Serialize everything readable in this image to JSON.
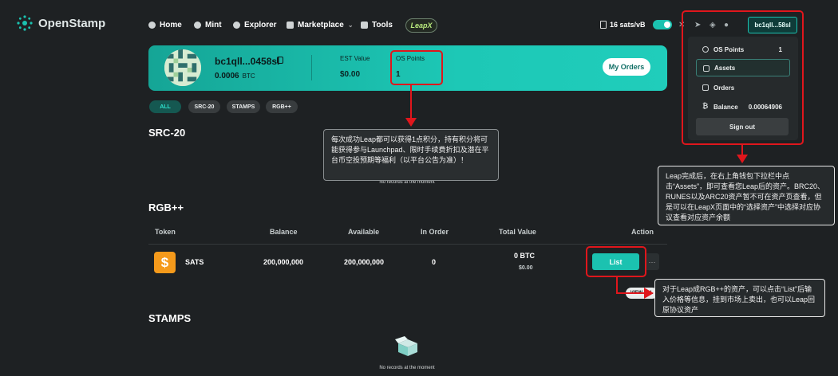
{
  "nav": {
    "brand": "OpenStamp",
    "items": [
      "Home",
      "Mint",
      "Explorer",
      "Marketplace",
      "Tools"
    ],
    "leapx_label": "LeapX",
    "fee": "16 sats/vB",
    "wallet_button": "bc1qll...58sl",
    "social_icons": [
      "x-icon",
      "telegram-icon",
      "gitbook-icon",
      "github-icon"
    ],
    "accent_color": "#1bc2b0"
  },
  "profile": {
    "address": "bc1qll...0458sl",
    "balance_value": "0.0006",
    "balance_unit": "BTC",
    "est_value_label": "EST Value",
    "est_value": "$0.00",
    "os_points_label": "OS Points",
    "os_points_value": "1",
    "my_orders_label": "My Orders"
  },
  "filter_tabs": [
    "ALL",
    "SRC-20",
    "STAMPS",
    "RGB++"
  ],
  "src20": {
    "title": "SRC-20",
    "empty_text": "No records at the moment"
  },
  "rgb": {
    "title": "RGB++",
    "columns": [
      "Token",
      "Balance",
      "Available",
      "In Order",
      "Total Value",
      "Action"
    ],
    "rows": [
      {
        "token": "SATS",
        "balance": "200,000,000",
        "available": "200,000,000",
        "in_order": "0",
        "total_btc": "0 BTC",
        "total_usd": "$0.00",
        "action_label": "List",
        "more_label": "···"
      }
    ],
    "view_all_label": "VIEW ALL"
  },
  "stamps": {
    "title": "STAMPS",
    "empty_text": "No records at the moment"
  },
  "dropdown": {
    "items": [
      {
        "label": "OS Points",
        "value": "1"
      },
      {
        "label": "Assets",
        "value": ""
      },
      {
        "label": "Orders",
        "value": ""
      },
      {
        "label": "Balance",
        "value": "0.00064906"
      }
    ],
    "sign_out_label": "Sign out"
  },
  "annotations": {
    "points_tip": "每次成功Leap都可以获得1点积分，持有积分将可能获得参与Launchpad、限时手续费折扣及潜在平台币空投预期等福利（以平台公告为准）！",
    "assets_tip": "Leap完成后，在右上角钱包下拉栏中点击“Assets”，即可查看您Leap后的资产。BRC20、RUNES以及ARC20资产暂不可在资产页查看，但是可以在LeapX页面中的“选择资产”中选择对应协议查看对应资产余额",
    "list_tip": "对于Leap成RGB++的资产，可以点击“List”后输入价格等信息，挂到市场上卖出，也可以Leap回原协议资产",
    "highlight_color": "#e0161c"
  }
}
